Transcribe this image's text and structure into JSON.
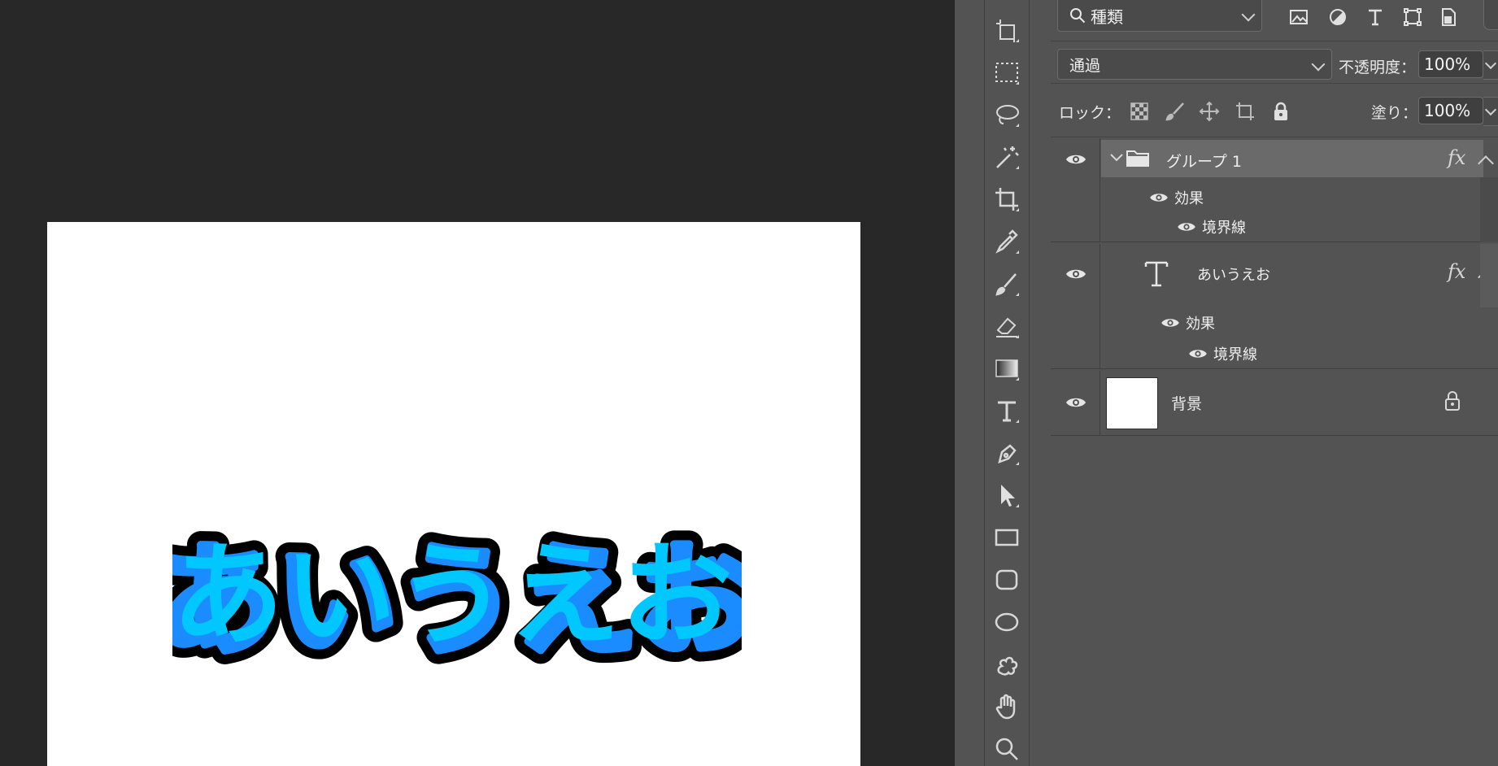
{
  "canvas": {
    "text": "あいうえお",
    "fill_color": "#1a8cff",
    "highlight_color": "#00c8ff",
    "stroke_color": "#000000",
    "document_background": "#ffffff"
  },
  "toolbar": {
    "tools": [
      "artboard-tool",
      "rectangular-marquee-tool",
      "lasso-tool",
      "magic-wand-tool",
      "crop-tool",
      "eyedropper-tool",
      "brush-tool",
      "eraser-tool",
      "gradient-tool",
      "type-tool",
      "pen-tool",
      "path-selection-tool",
      "rectangle-tool",
      "rounded-rectangle-tool",
      "ellipse-tool",
      "custom-shape-tool",
      "hand-tool",
      "zoom-tool"
    ]
  },
  "layers_panel": {
    "filter": {
      "label": "種類",
      "icons": [
        "image-filter-icon",
        "adjustment-filter-icon",
        "type-filter-icon",
        "shape-filter-icon",
        "smart-object-filter-icon"
      ]
    },
    "blend_mode": "通過",
    "opacity_label": "不透明度：",
    "opacity_value": "100%",
    "lock_label": "ロック：",
    "fill_label": "塗り：",
    "fill_value": "100%",
    "layers": [
      {
        "name": "グループ 1",
        "type": "group",
        "fx": "fx",
        "effects_label": "効果",
        "effect": "境界線"
      },
      {
        "name": "あいうえお",
        "type": "text",
        "fx": "fx",
        "effects_label": "効果",
        "effect": "境界線"
      },
      {
        "name": "背景",
        "type": "background"
      }
    ]
  }
}
